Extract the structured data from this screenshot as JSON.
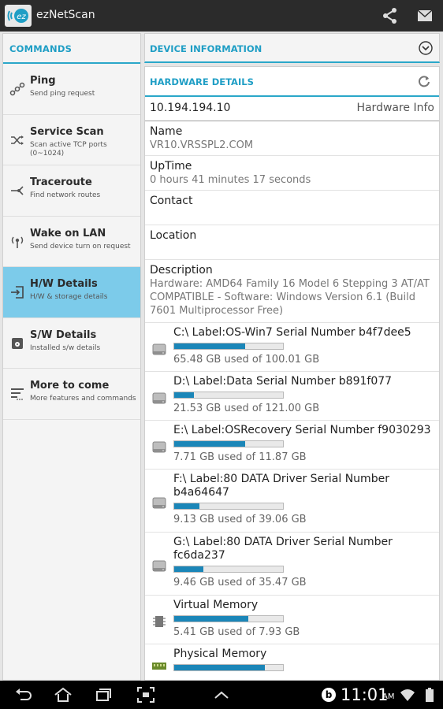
{
  "app": {
    "title": "ezNetScan",
    "logo_text": "ez"
  },
  "commands": {
    "header": "COMMANDS",
    "items": [
      {
        "title": "Ping",
        "desc": "Send ping request",
        "icon": "ping-icon"
      },
      {
        "title": "Service Scan",
        "desc": "Scan active TCP ports (0~1024)",
        "icon": "shuffle-icon"
      },
      {
        "title": "Traceroute",
        "desc": "Find network routes",
        "icon": "route-icon"
      },
      {
        "title": "Wake on LAN",
        "desc": "Send device turn on request",
        "icon": "wake-icon"
      },
      {
        "title": "H/W Details",
        "desc": "H/W & storage details",
        "icon": "hardware-icon"
      },
      {
        "title": "S/W Details",
        "desc": "Installed s/w details",
        "icon": "disc-icon"
      },
      {
        "title": "More to come",
        "desc": "More features and commands",
        "icon": "more-icon"
      }
    ],
    "active_index": 4
  },
  "device": {
    "header": "DEVICE INFORMATION",
    "hw_header": "HARDWARE DETAILS",
    "ip": "10.194.194.10",
    "hw_info_label": "Hardware Info",
    "name_label": "Name",
    "name_value": "VR10.VRSSPL2.COM",
    "uptime_label": "UpTime",
    "uptime_value": "0 hours 41 minutes 17 seconds",
    "contact_label": "Contact",
    "location_label": "Location",
    "description_label": "Description",
    "description_value": "Hardware: AMD64 Family 16 Model 6 Stepping 3 AT/AT COMPATIBLE - Software: Windows Version 6.1 (Build 7601 Multiprocessor Free)"
  },
  "drives": [
    {
      "title": "C:\\ Label:OS-Win7  Serial Number b4f7dee5",
      "usage": "65.48 GB used of 100.01 GB",
      "fill": 0.655,
      "icon": "drive-icon"
    },
    {
      "title": "D:\\ Label:Data  Serial Number b891f077",
      "usage": "21.53 GB used of 121.00 GB",
      "fill": 0.178,
      "icon": "drive-icon"
    },
    {
      "title": "E:\\ Label:OSRecovery  Serial Number f9030293",
      "usage": "7.71 GB used of 11.87 GB",
      "fill": 0.65,
      "icon": "drive-icon"
    },
    {
      "title": "F:\\ Label:80 DATA Driver  Serial Number b4a64647",
      "usage": "9.13 GB used of 39.06 GB",
      "fill": 0.234,
      "icon": "drive-icon"
    },
    {
      "title": "G:\\ Label:80 DATA Driver  Serial Number fc6da237",
      "usage": "9.46 GB used of 35.47 GB",
      "fill": 0.267,
      "icon": "drive-icon"
    },
    {
      "title": "Virtual Memory",
      "usage": "5.41 GB used of 7.93 GB",
      "fill": 0.682,
      "icon": "chip-icon"
    },
    {
      "title": "Physical Memory",
      "usage": "",
      "fill": 0.83,
      "icon": "ram-icon"
    }
  ],
  "status": {
    "time": "11:01",
    "ampm": "AM"
  },
  "colors": {
    "accent": "#2aa7c9",
    "active": "#7ccbea",
    "bar": "#1b86b8"
  }
}
